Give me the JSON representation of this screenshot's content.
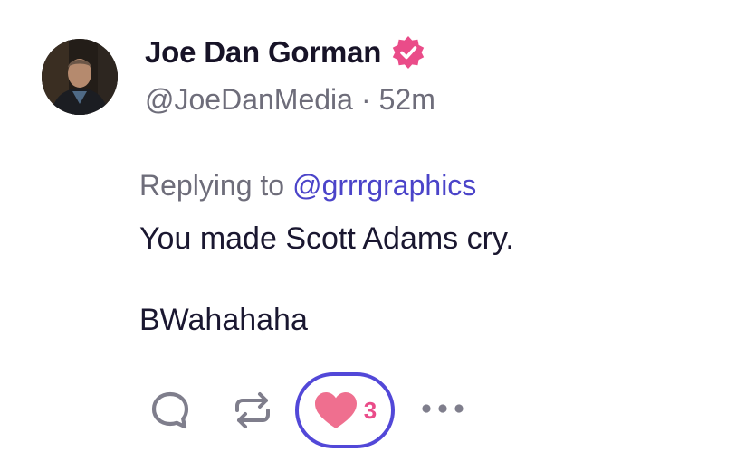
{
  "post": {
    "author": {
      "display_name": "Joe Dan Gorman",
      "handle": "@JoeDanMedia",
      "verified": true,
      "avatar": "profile-photo"
    },
    "time_separator": "·",
    "time_ago": "52m",
    "reply_prefix": "Replying to",
    "reply_handle": "@grrrgraphics",
    "body_lines": [
      "You made Scott Adams cry.",
      "BWahahaha"
    ],
    "actions": {
      "reply_icon": "speech-bubble-icon",
      "repost_icon": "repost-arrows-icon",
      "like_icon": "heart-icon",
      "like_count": "3",
      "more_icon": "ellipsis-icon",
      "liked": true
    }
  },
  "colors": {
    "accent": "#5248d8",
    "link": "#4b44c9",
    "like_pink": "#ea4c89",
    "heart_fill": "#ef6f8f",
    "verified_badge": "#ea4c89",
    "secondary_text": "#6e6d7a",
    "icon_gray": "#7f7e8c"
  }
}
